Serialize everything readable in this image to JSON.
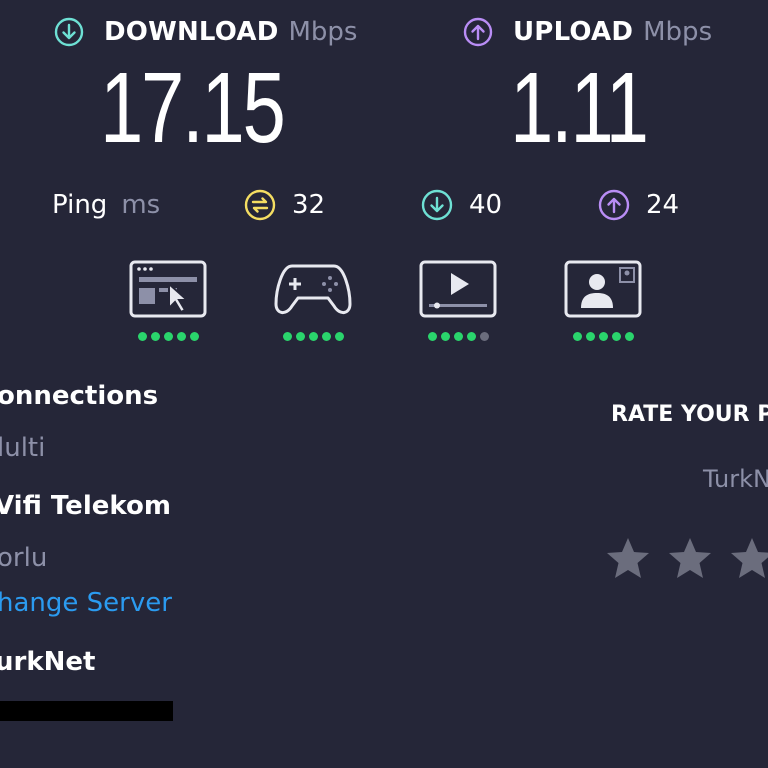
{
  "download": {
    "title": "DOWNLOAD",
    "unit": "Mbps",
    "value": "17.15",
    "icon": "download-icon",
    "color": "#6ee0d4"
  },
  "upload": {
    "title": "UPLOAD",
    "unit": "Mbps",
    "value": "1.11",
    "icon": "upload-icon",
    "color": "#b98df5"
  },
  "ping": {
    "label": "Ping",
    "unit": "ms",
    "idle": {
      "value": "32",
      "icon": "ping-idle-icon",
      "color": "#f4dd62"
    },
    "download": {
      "value": "40",
      "icon": "download-icon",
      "color": "#6ee0d4"
    },
    "upload": {
      "value": "24",
      "icon": "upload-icon",
      "color": "#b98df5"
    }
  },
  "quality": [
    {
      "icon": "web-browsing-icon",
      "rating": 5,
      "max": 5
    },
    {
      "icon": "gaming-controller-icon",
      "rating": 5,
      "max": 5
    },
    {
      "icon": "video-streaming-icon",
      "rating": 4,
      "max": 5
    },
    {
      "icon": "video-call-icon",
      "rating": 5,
      "max": 5
    }
  ],
  "colors": {
    "dot_on": "#2ad46c",
    "dot_off": "#6b6d7d",
    "link": "#2b9bf0",
    "background": "#252638"
  },
  "left_panel": {
    "connections_label": "onnections",
    "connections_value": "lulti",
    "host_name": "Vifi Telekom",
    "host_location": "orlu",
    "change_server": "hange Server",
    "provider": "urkNet"
  },
  "rate": {
    "title": "RATE YOUR P",
    "provider": "TurkN",
    "stars_visible": 3
  }
}
